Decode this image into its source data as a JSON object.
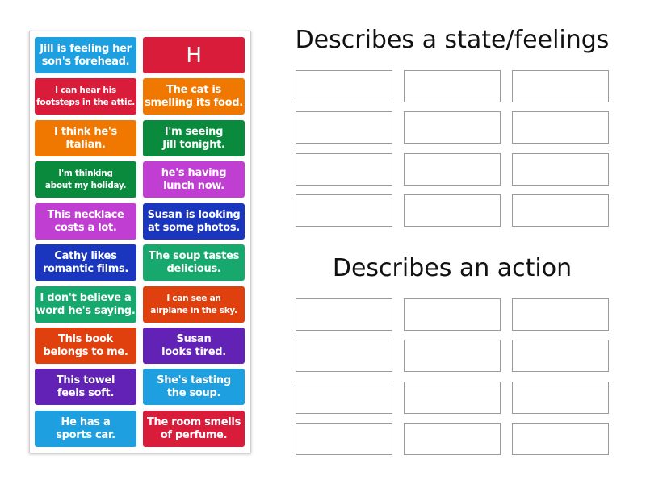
{
  "tiles": [
    {
      "text": "Jill is feeling her\nson's forehead.",
      "color": "#1e9fe0"
    },
    {
      "text": "H",
      "color": "#d91c3a",
      "big": true
    },
    {
      "text": "I can hear his\nfootsteps in the attic.",
      "color": "#d91c3a",
      "small": true
    },
    {
      "text": "The cat is\nsmelling its food.",
      "color": "#f07800"
    },
    {
      "text": "I think he's\nItalian.",
      "color": "#f07800"
    },
    {
      "text": "I'm seeing\nJill tonight.",
      "color": "#0a8a3c"
    },
    {
      "text": "I'm thinking\nabout my holiday.",
      "color": "#0a8a3c",
      "small": true
    },
    {
      "text": "he's having\nlunch now.",
      "color": "#c03fd2"
    },
    {
      "text": "This necklace\ncosts a lot.",
      "color": "#c03fd2"
    },
    {
      "text": "Susan is looking\nat some photos.",
      "color": "#1a36bf"
    },
    {
      "text": "Cathy likes\nromantic films.",
      "color": "#1a36bf"
    },
    {
      "text": "The soup tastes\ndelicious.",
      "color": "#17a86e"
    },
    {
      "text": "I don't believe a\nword he's saying.",
      "color": "#17a86e"
    },
    {
      "text": "I can see an\nairplane in the sky.",
      "color": "#e0400e",
      "small": true
    },
    {
      "text": "This book\nbelongs to me.",
      "color": "#e0400e"
    },
    {
      "text": "Susan\nlooks tired.",
      "color": "#6322b6"
    },
    {
      "text": "This towel\nfeels soft.",
      "color": "#6322b6"
    },
    {
      "text": "She's tasting\nthe soup.",
      "color": "#1e9fe0"
    },
    {
      "text": "He has a\nsports car.",
      "color": "#1e9fe0"
    },
    {
      "text": "The room smells\nof perfume.",
      "color": "#d91c3a"
    }
  ],
  "groups": [
    {
      "title": "Describes a state/feelings",
      "slots": 12
    },
    {
      "title": "Describes an action",
      "slots": 12
    }
  ]
}
